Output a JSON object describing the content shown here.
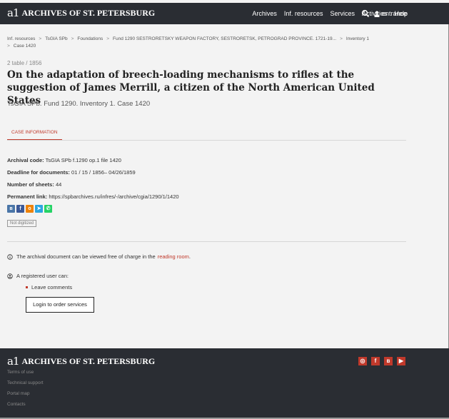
{
  "header": {
    "logo_mark": "a1",
    "logo_text": "ARCHIVES OF ST. PETERSBURG",
    "nav": [
      "Archives",
      "Inf. resources",
      "Services",
      "Activities",
      "Help"
    ],
    "entrance_label": "entrance"
  },
  "breadcrumb": {
    "items": [
      "Inf. resources",
      "TsGIA SPb",
      "Foundations",
      "Fund 1290 SESTRORETSKY WEAPON FACTORY, SESTRORETSK, PETROGRAD PROVINCE. 1721-19...",
      "Inventory 1",
      "Case 1420"
    ]
  },
  "document": {
    "small_subtitle": "2 table / 1856",
    "title": "On the adaptation of breech-loading mechanisms to rifles at the suggestion of James Merrill, a citizen of the North American United States",
    "case_ref": "TsGIA SPb. Fund 1290. Inventory 1. Case 1420"
  },
  "tabs": {
    "case_information": "CASE INFORMATION"
  },
  "fields": {
    "archival_code_label": "Archival code:",
    "archival_code_value": " TsGIA SPb f.1290 op.1 file 1420",
    "deadline_label": "Deadline for documents:",
    "deadline_value": " 01 / 15 / 1856– 04/26/1859",
    "sheets_label": "Number of sheets:",
    "sheets_value": " 44",
    "permalink_label": "Permanent link:",
    "permalink_value": " https://spbarchives.ru/infres/-/archive/cgia/1290/1/1420"
  },
  "share": {
    "icons": [
      "vk-icon",
      "facebook-icon",
      "odnoklassniki-icon",
      "telegram-icon",
      "whatsapp-icon"
    ],
    "colors": [
      "#4a76a8",
      "#3b5998",
      "#ee8208",
      "#2ca5e0",
      "#25d366"
    ]
  },
  "status": {
    "not_digitized": "Not digitized"
  },
  "info": {
    "viewing_text": "The archival document can be viewed free of charge in the",
    "reading_room_link": "reading room",
    "period": ".",
    "registered_text": "A registered user can:",
    "leave_comments": "Leave comments",
    "login_button": "Login to order services"
  },
  "footer": {
    "logo_mark": "a1",
    "logo_text": "ARCHIVES OF ST. PETERSBURG",
    "links": [
      "Terms of use",
      "Technical support",
      "Portal map",
      "Contacts"
    ],
    "social_icons": [
      "instagram-icon",
      "facebook-icon",
      "vk-icon",
      "youtube-icon"
    ],
    "accent_color": "#c0392b"
  }
}
